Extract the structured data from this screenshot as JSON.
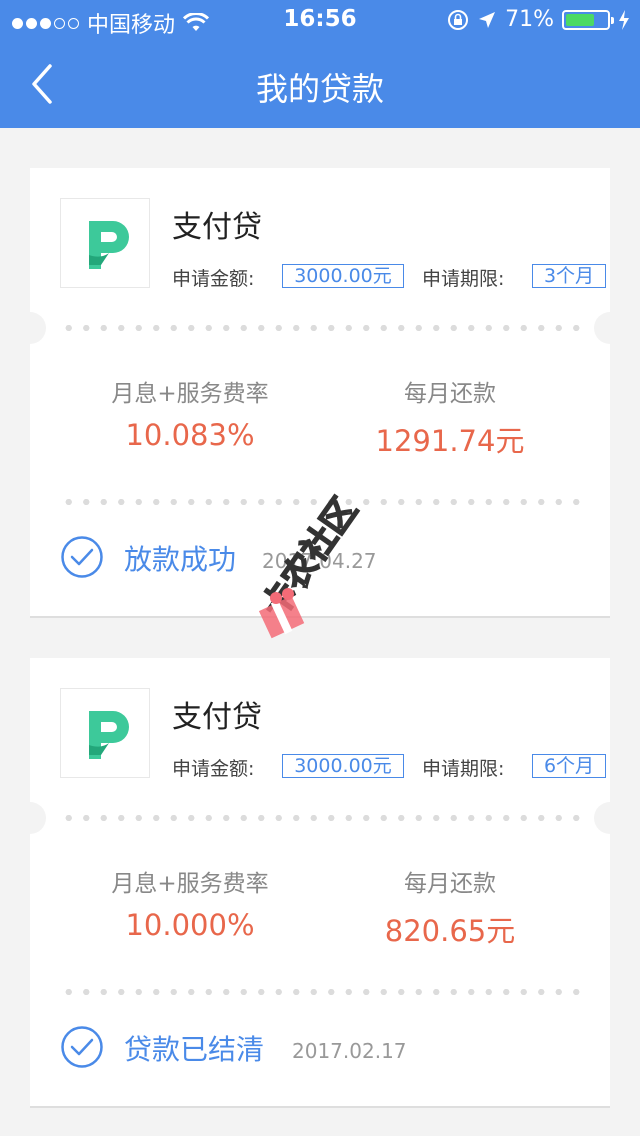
{
  "status_bar": {
    "carrier": "中国移动",
    "time": "16:56",
    "battery": "71%",
    "battery_level": 0.71
  },
  "nav": {
    "title": "我的贷款",
    "back_icon": "chevron-left-icon"
  },
  "loans": [
    {
      "product_name": "支付贷",
      "amount_label": "申请金额:",
      "amount": "3000.00元",
      "term_label": "申请期限:",
      "term": "3个月",
      "rate_label": "月息+服务费率",
      "rate": "10.083%",
      "monthly_label": "每月还款",
      "monthly": "1291.74元",
      "status": "放款成功",
      "date": "2017.04.27"
    },
    {
      "product_name": "支付贷",
      "amount_label": "申请金额:",
      "amount": "3000.00元",
      "term_label": "申请期限:",
      "term": "6个月",
      "rate_label": "月息+服务费率",
      "rate": "10.000%",
      "monthly_label": "每月还款",
      "monthly": "820.65元",
      "status": "贷款已结清",
      "date": "2017.02.17"
    }
  ],
  "watermark": {
    "text": "卡农社区"
  },
  "colors": {
    "accent": "#4a8ae8",
    "value": "#e8674b",
    "logo_green": "#3dc99a"
  }
}
